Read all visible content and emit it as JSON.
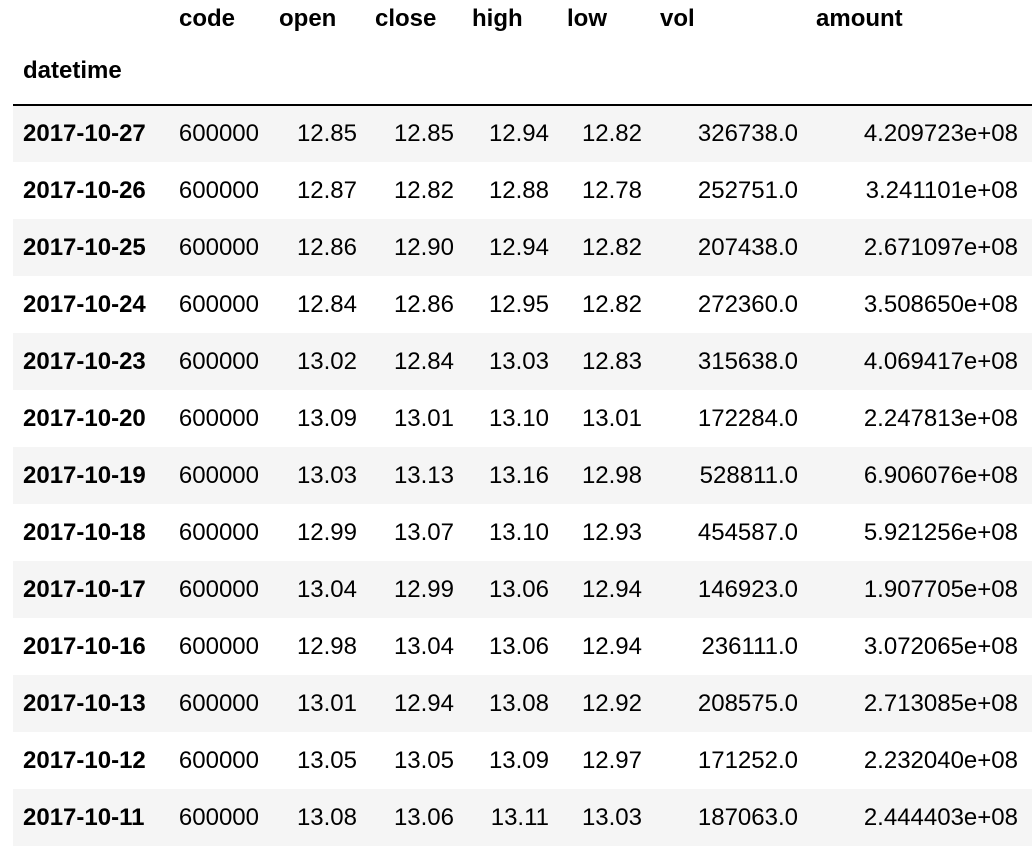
{
  "table": {
    "columns": [
      "code",
      "open",
      "close",
      "high",
      "low",
      "vol",
      "amount"
    ],
    "index_name": "datetime",
    "rows": [
      {
        "datetime": "2017-10-27",
        "code": "600000",
        "open": "12.85",
        "close": "12.85",
        "high": "12.94",
        "low": "12.82",
        "vol": "326738.0",
        "amount": "4.209723e+08"
      },
      {
        "datetime": "2017-10-26",
        "code": "600000",
        "open": "12.87",
        "close": "12.82",
        "high": "12.88",
        "low": "12.78",
        "vol": "252751.0",
        "amount": "3.241101e+08"
      },
      {
        "datetime": "2017-10-25",
        "code": "600000",
        "open": "12.86",
        "close": "12.90",
        "high": "12.94",
        "low": "12.82",
        "vol": "207438.0",
        "amount": "2.671097e+08"
      },
      {
        "datetime": "2017-10-24",
        "code": "600000",
        "open": "12.84",
        "close": "12.86",
        "high": "12.95",
        "low": "12.82",
        "vol": "272360.0",
        "amount": "3.508650e+08"
      },
      {
        "datetime": "2017-10-23",
        "code": "600000",
        "open": "13.02",
        "close": "12.84",
        "high": "13.03",
        "low": "12.83",
        "vol": "315638.0",
        "amount": "4.069417e+08"
      },
      {
        "datetime": "2017-10-20",
        "code": "600000",
        "open": "13.09",
        "close": "13.01",
        "high": "13.10",
        "low": "13.01",
        "vol": "172284.0",
        "amount": "2.247813e+08"
      },
      {
        "datetime": "2017-10-19",
        "code": "600000",
        "open": "13.03",
        "close": "13.13",
        "high": "13.16",
        "low": "12.98",
        "vol": "528811.0",
        "amount": "6.906076e+08"
      },
      {
        "datetime": "2017-10-18",
        "code": "600000",
        "open": "12.99",
        "close": "13.07",
        "high": "13.10",
        "low": "12.93",
        "vol": "454587.0",
        "amount": "5.921256e+08"
      },
      {
        "datetime": "2017-10-17",
        "code": "600000",
        "open": "13.04",
        "close": "12.99",
        "high": "13.06",
        "low": "12.94",
        "vol": "146923.0",
        "amount": "1.907705e+08"
      },
      {
        "datetime": "2017-10-16",
        "code": "600000",
        "open": "12.98",
        "close": "13.04",
        "high": "13.06",
        "low": "12.94",
        "vol": "236111.0",
        "amount": "3.072065e+08"
      },
      {
        "datetime": "2017-10-13",
        "code": "600000",
        "open": "13.01",
        "close": "12.94",
        "high": "13.08",
        "low": "12.92",
        "vol": "208575.0",
        "amount": "2.713085e+08"
      },
      {
        "datetime": "2017-10-12",
        "code": "600000",
        "open": "13.05",
        "close": "13.05",
        "high": "13.09",
        "low": "12.97",
        "vol": "171252.0",
        "amount": "2.232040e+08"
      },
      {
        "datetime": "2017-10-11",
        "code": "600000",
        "open": "13.08",
        "close": "13.06",
        "high": "13.11",
        "low": "13.03",
        "vol": "187063.0",
        "amount": "2.444403e+08"
      }
    ]
  },
  "colors": {
    "row_stripe": "#f5f5f5",
    "header_rule": "#000000",
    "text": "#000000"
  }
}
